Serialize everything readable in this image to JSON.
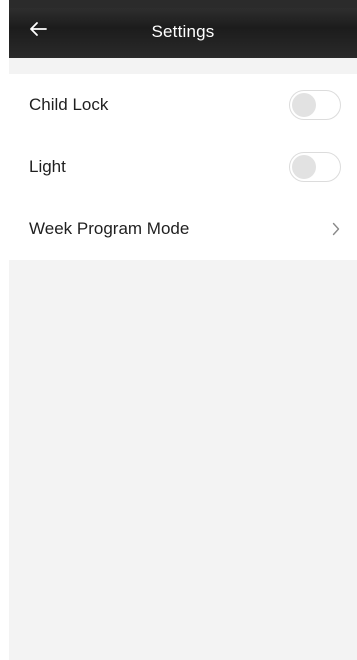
{
  "header": {
    "title": "Settings",
    "back_icon": "arrow-left-icon"
  },
  "settings": {
    "items": [
      {
        "label": "Child Lock",
        "control": "toggle",
        "state": "off"
      },
      {
        "label": "Light",
        "control": "toggle",
        "state": "off"
      },
      {
        "label": "Week Program Mode",
        "control": "chevron",
        "icon": "chevron-right-icon"
      }
    ]
  },
  "colors": {
    "header_bg": "#262626",
    "page_bg": "#f3f3f3",
    "row_bg": "#ffffff",
    "text": "#1f1f1f",
    "toggle_off_knob": "#e2e2e2"
  }
}
